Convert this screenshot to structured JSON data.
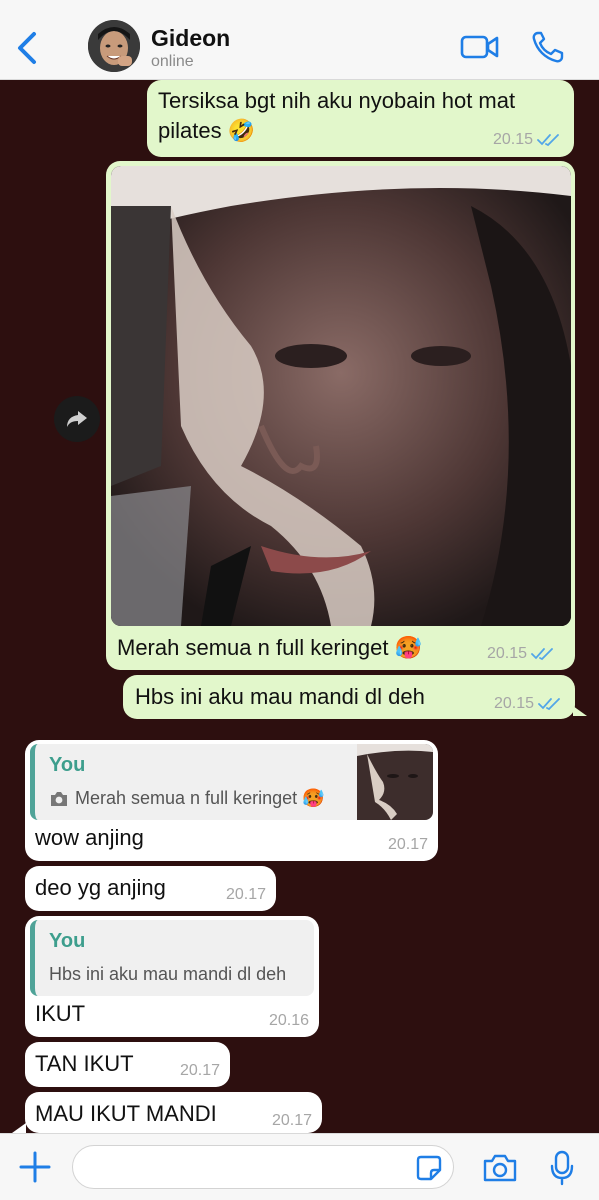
{
  "header": {
    "contact_name": "Gideon",
    "status": "online"
  },
  "messages": [
    {
      "text_line1": "Tersiksa bgt nih aku nyobain hot mat",
      "text_line2": "pilates 🤣",
      "time": "20.15"
    },
    {
      "caption": "Merah semua n full keringet 🥵",
      "time": "20.15"
    },
    {
      "text": "Hbs ini aku mau mandi dl deh",
      "time": "20.15"
    },
    {
      "quote_name": "You",
      "quote_text": "Merah semua n full keringet 🥵",
      "text": "wow anjing",
      "time": "20.17"
    },
    {
      "text": "deo yg anjing",
      "time": "20.17"
    },
    {
      "quote_name": "You",
      "quote_text": "Hbs ini aku mau mandi dl deh",
      "text": "IKUT",
      "time": "20.16"
    },
    {
      "text": "TAN IKUT",
      "time": "20.17"
    },
    {
      "text": "MAU IKUT MANDI",
      "time": "20.17"
    }
  ],
  "colors": {
    "background": "#2d0f0f",
    "outgoing_bubble": "#e2f7cb",
    "incoming_bubble": "#ffffff",
    "accent_blue": "#1f7ee6",
    "quote_accent": "#4fa398"
  },
  "icons": [
    "back-chevron-icon",
    "video-call-icon",
    "voice-call-icon",
    "forward-icon",
    "read-ticks-icon",
    "camera-small-icon",
    "plus-icon",
    "sticker-icon",
    "camera-icon",
    "microphone-icon"
  ]
}
